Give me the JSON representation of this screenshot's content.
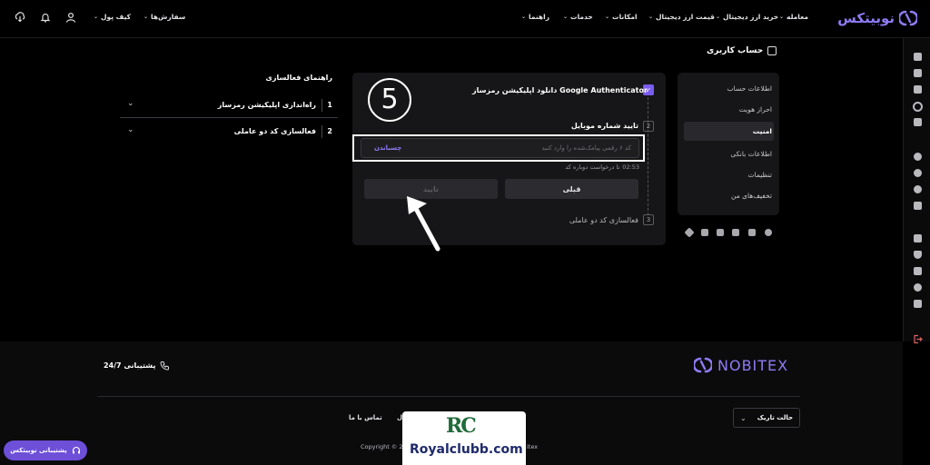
{
  "header": {
    "logo": "نوبیتکس",
    "nav": [
      "معامله",
      "خرید ارز دیجیتال",
      "قیمت ارز دیجیتال",
      "امکانات",
      "خدمات",
      "راهنما"
    ],
    "orders": "سفارش‌ها",
    "wallet": "کیف پول"
  },
  "page": {
    "title": "حساب کاربری"
  },
  "sidebar": {
    "items": [
      "اطلاعات حساب",
      "احراز هویت",
      "امنیت",
      "اطلاعات بانکی",
      "تنظیمات",
      "تخفیف‌های من"
    ]
  },
  "steps": {
    "step1": "دانلود اپلیکیشن رمزساز Google Authenticator",
    "step2_num": "2",
    "step2": "تایید شماره موبایل",
    "code_placeholder": "کد ۶ رقمی پیامک‌شده را وارد کنید",
    "paste_label": "چسباندن",
    "timer": "02:53",
    "resend": "تا درخواست دوباره کد",
    "prev_button": "قبلی",
    "confirm_button": "تایید",
    "step3_num": "3",
    "step3": "فعالسازی کد دو عاملی"
  },
  "annotation": {
    "circle_number": "5"
  },
  "guide": {
    "title": "راهنمای فعالسازی",
    "items": [
      {
        "num": "1",
        "label": "راه‌اندازی اپلیکیشن رمزساز"
      },
      {
        "num": "2",
        "label": "فعالسازی کد دو عاملی"
      }
    ]
  },
  "footer": {
    "brand": "NOBITEX",
    "support": "پشتیبانی 24/7",
    "theme": "حالت تاریک",
    "contact": "تماس با ما",
    "partial_link": "ل",
    "copyright": "Copyright © 201",
    "copyright_tail": "itex",
    "support_button": "پشتیبانی نوبیتکس"
  },
  "watermark": {
    "brand_mark": "RC",
    "site": "Royalclubb.com"
  },
  "colors": {
    "accent": "#7a5cf0",
    "background": "#000000",
    "card": "#161618"
  }
}
